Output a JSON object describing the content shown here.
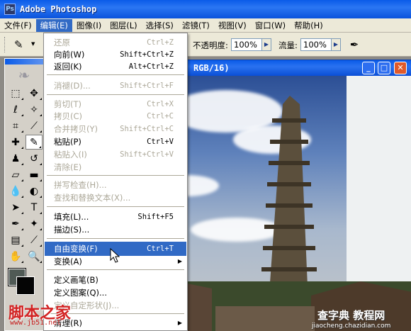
{
  "window": {
    "title": "Adobe Photoshop",
    "app_icon": "Ps"
  },
  "menubar": [
    {
      "label": "文件(F)"
    },
    {
      "label": "编辑(E)"
    },
    {
      "label": "图像(I)"
    },
    {
      "label": "图层(L)"
    },
    {
      "label": "选择(S)"
    },
    {
      "label": "滤镜(T)"
    },
    {
      "label": "视图(V)"
    },
    {
      "label": "窗口(W)"
    },
    {
      "label": "帮助(H)"
    }
  ],
  "options_bar": {
    "opacity_label": "不透明度:",
    "opacity_value": "100%",
    "flow_label": "流量:",
    "flow_value": "100%",
    "airbrush_icon": "airbrush-icon"
  },
  "document": {
    "title": "RGB/16)"
  },
  "edit_menu": {
    "items": [
      {
        "label": "还原",
        "shortcut": "Ctrl+Z",
        "disabled": true
      },
      {
        "label": "向前(W)",
        "shortcut": "Shift+Ctrl+Z",
        "disabled": false
      },
      {
        "label": "返回(K)",
        "shortcut": "Alt+Ctrl+Z",
        "disabled": false
      },
      {
        "label": "消褪(D)...",
        "shortcut": "Shift+Ctrl+F",
        "disabled": true
      },
      {
        "label": "剪切(T)",
        "shortcut": "Ctrl+X",
        "disabled": true
      },
      {
        "label": "拷贝(C)",
        "shortcut": "Ctrl+C",
        "disabled": true
      },
      {
        "label": "合并拷贝(Y)",
        "shortcut": "Shift+Ctrl+C",
        "disabled": true
      },
      {
        "label": "粘贴(P)",
        "shortcut": "Ctrl+V",
        "disabled": false
      },
      {
        "label": "粘贴入(I)",
        "shortcut": "Shift+Ctrl+V",
        "disabled": true
      },
      {
        "label": "清除(E)",
        "shortcut": "",
        "disabled": true
      },
      {
        "label": "拼写检查(H)...",
        "shortcut": "",
        "disabled": true
      },
      {
        "label": "查找和替换文本(X)...",
        "shortcut": "",
        "disabled": true
      },
      {
        "label": "填充(L)...",
        "shortcut": "Shift+F5",
        "disabled": false
      },
      {
        "label": "描边(S)...",
        "shortcut": "",
        "disabled": false
      },
      {
        "label": "自由变换(F)",
        "shortcut": "Ctrl+T",
        "disabled": false,
        "highlighted": true
      },
      {
        "label": "变换(A)",
        "shortcut": "",
        "disabled": false,
        "submenu": true
      },
      {
        "label": "定义画笔(B)",
        "shortcut": "",
        "disabled": false
      },
      {
        "label": "定义图案(Q)...",
        "shortcut": "",
        "disabled": false
      },
      {
        "label": "定义自定形状(J)...",
        "shortcut": "",
        "disabled": true
      },
      {
        "label": "清理(R)",
        "shortcut": "",
        "disabled": false,
        "submenu": true
      }
    ],
    "submenu_arrow": "▶"
  },
  "watermarks": {
    "left": "脚本之家",
    "left_url": "www.jb51.net",
    "right": "查字典 教程网",
    "right_url": "jiaocheng.chazidian.com"
  },
  "colors": {
    "titlebar": "#0a5be8",
    "menu_highlight": "#316ac5",
    "foreground": "#505a55",
    "background": "#050505"
  }
}
